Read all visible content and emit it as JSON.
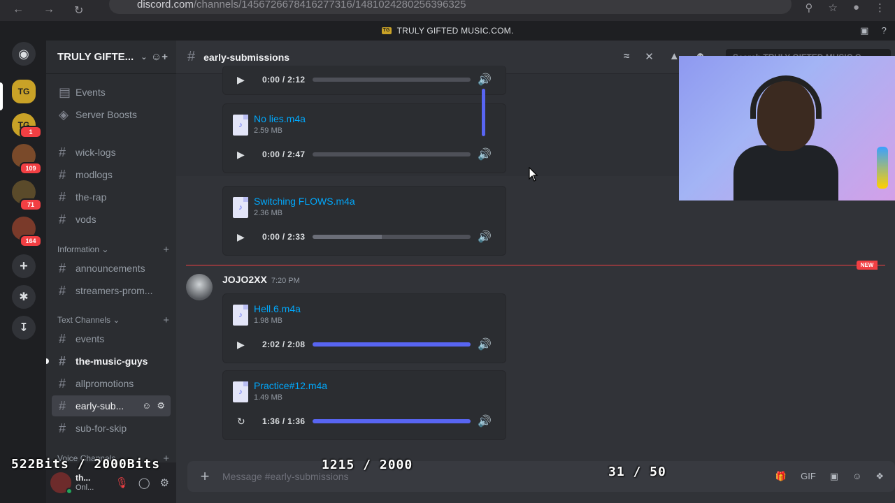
{
  "browser": {
    "url_host": "discord.com",
    "url_path": "/channels/1456726678416277316/1481024280256396325"
  },
  "window": {
    "title": "TRULY GIFTED MUSIC.COM."
  },
  "guilds": [
    {
      "label": "TG",
      "badge": ""
    },
    {
      "label": "TG",
      "badge": "1"
    },
    {
      "label": "",
      "badge": "109"
    },
    {
      "label": "",
      "badge": "71"
    },
    {
      "label": "",
      "badge": "164"
    }
  ],
  "sidebar": {
    "server_name": "TRULY GIFTE...",
    "top_items": [
      "Events",
      "Server Boosts"
    ],
    "channels_a": [
      "wick-logs",
      "modlogs",
      "the-rap",
      "vods"
    ],
    "cat_information": "Information",
    "channels_b": [
      "announcements",
      "streamers-prom..."
    ],
    "cat_text": "Text Channels",
    "channels_c": [
      "events",
      "the-music-guys",
      "allpromotions",
      "early-sub...",
      "sub-for-skip"
    ],
    "cat_voice": "Voice Channels"
  },
  "user": {
    "name": "th...",
    "status": "Onl..."
  },
  "channel": {
    "name": "early-submissions",
    "search_placeholder": "Search TRULY GIFTED MUSIC.C"
  },
  "attachments": [
    {
      "name": "",
      "size": "",
      "time": "0:00 / 2:12",
      "progress": 0.0
    },
    {
      "name": "No lies.m4a",
      "size": "2.59 MB",
      "time": "0:00 / 2:47",
      "progress": 0.0
    },
    {
      "name": "Switching FLOWS.m4a",
      "size": "2.36 MB",
      "time": "0:00 / 2:33",
      "progress": 0.0
    },
    {
      "name": "Hell.6.m4a",
      "size": "1.98 MB",
      "time": "2:02 / 2:08",
      "progress": 1.0
    },
    {
      "name": "Practice#12.m4a",
      "size": "1.49 MB",
      "time": "1:36 / 1:36",
      "progress": 1.0
    }
  ],
  "message": {
    "author": "JOJO2XX",
    "timestamp": "7:20 PM",
    "new_label": "NEW"
  },
  "composer": {
    "placeholder": "Message #early-submissions"
  },
  "overlays": {
    "bits": "522Bits / 2000Bits",
    "count_a": "1215 / 2000",
    "count_b": "31 / 50"
  },
  "colors": {
    "accent": "#5865f2",
    "link": "#00a8fc",
    "danger": "#f23f43",
    "online": "#23a55a"
  }
}
